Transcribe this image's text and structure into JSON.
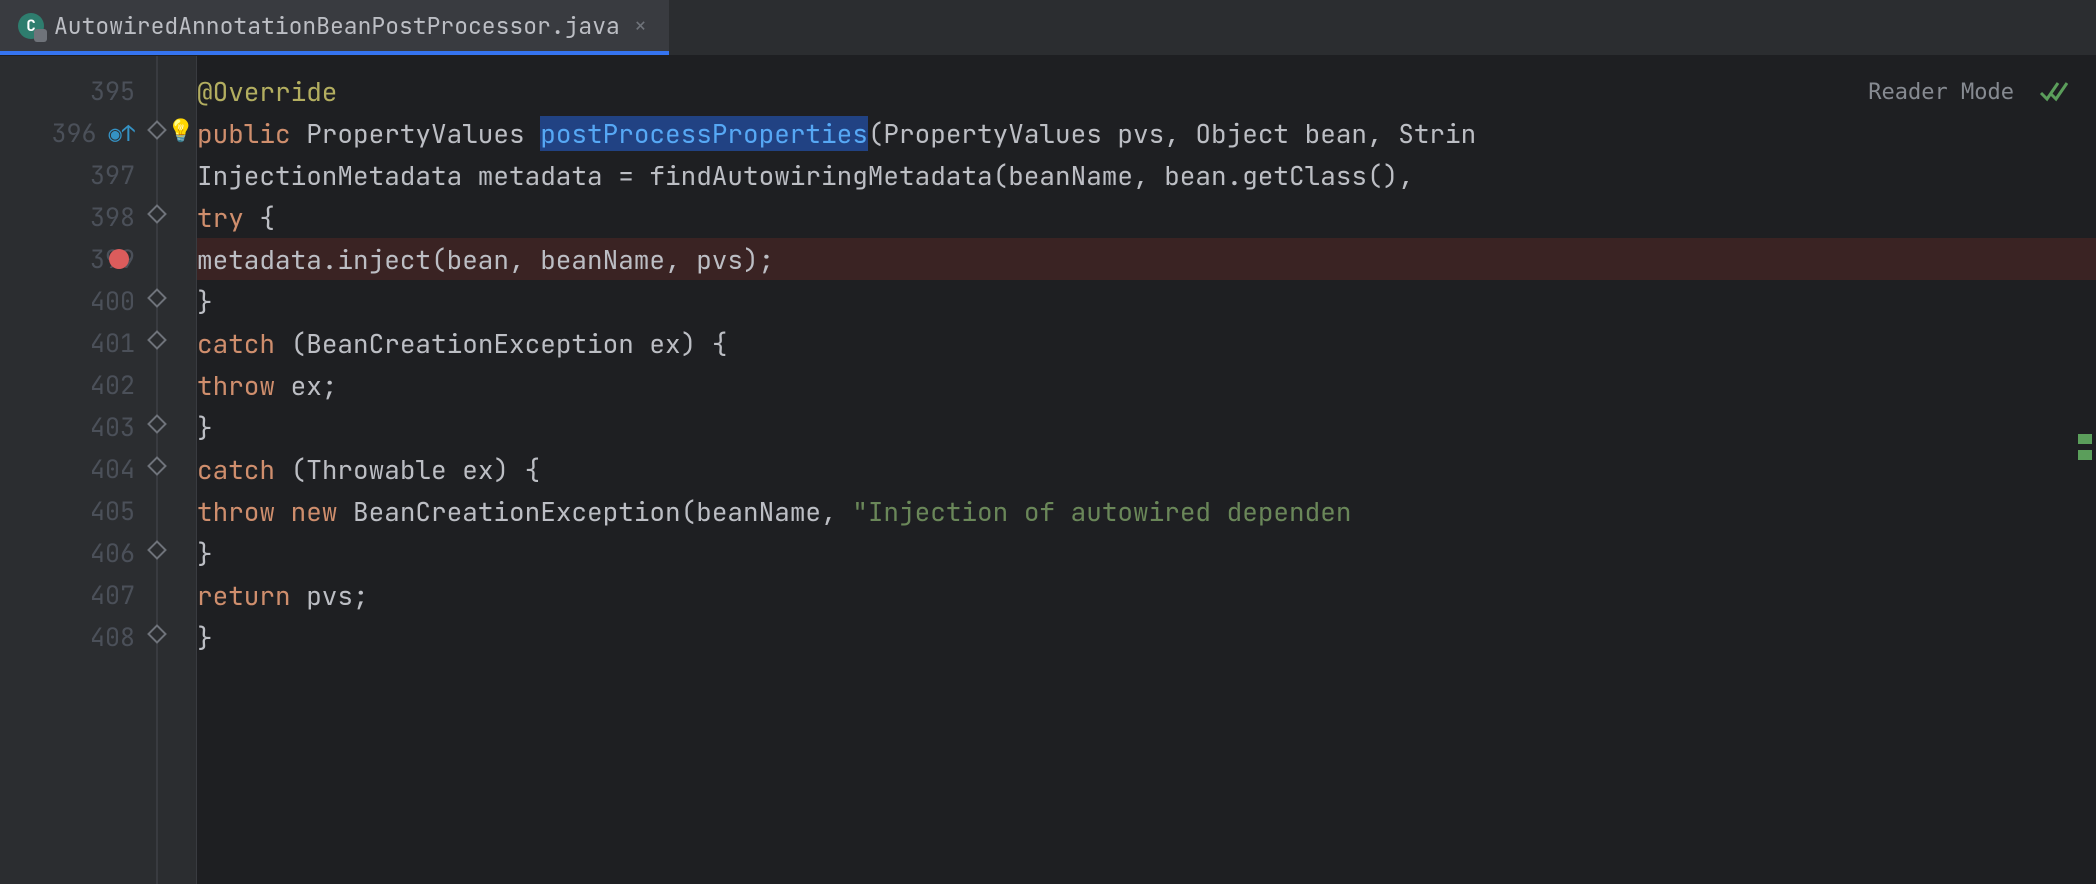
{
  "tab": {
    "icon_letter": "C",
    "filename": "AutowiredAnnotationBeanPostProcessor.java"
  },
  "reader_mode_label": "Reader Mode",
  "gutter": {
    "lines": [
      "395",
      "396",
      "397",
      "398",
      "399",
      "400",
      "401",
      "402",
      "403",
      "404",
      "405",
      "406",
      "407",
      "408"
    ]
  },
  "code": {
    "l395": {
      "ann": "@Override"
    },
    "l396": {
      "kw1": "public ",
      "type": "PropertyValues ",
      "name": "postProcessProperties",
      "rest": "(PropertyValues pvs, Object bean, Strin"
    },
    "l397": {
      "text1": "InjectionMetadata metadata = ",
      "call": "findAutowiringMetadata",
      "text2": "(beanName, bean.getClass(),"
    },
    "l398": {
      "kw": "try",
      "brace": " {"
    },
    "l399": {
      "text": "metadata.inject(bean, beanName, pvs);"
    },
    "l400": {
      "brace": "}"
    },
    "l401": {
      "kw": "catch",
      "text": " (BeanCreationException ex) {"
    },
    "l402": {
      "kw": "throw",
      "text": " ex;"
    },
    "l403": {
      "brace": "}"
    },
    "l404": {
      "kw": "catch",
      "text": " (Throwable ex) {"
    },
    "l405": {
      "kw1": "throw ",
      "kw2": "new ",
      "text1": "BeanCreationException(beanName, ",
      "str": "\"Injection of autowired dependen"
    },
    "l406": {
      "brace": "}"
    },
    "l407": {
      "kw": "return",
      "text": " pvs;"
    },
    "l408": {
      "brace": "}"
    }
  }
}
